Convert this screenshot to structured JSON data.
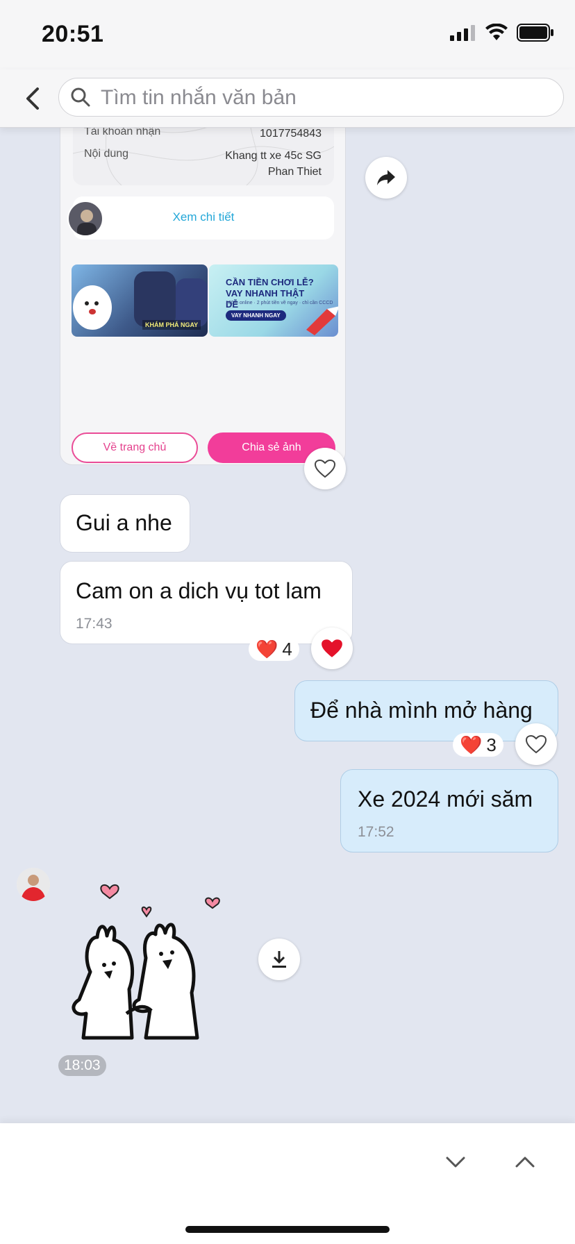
{
  "status_bar": {
    "time": "20:51"
  },
  "search": {
    "placeholder": "Tìm tin nhắn văn bản"
  },
  "receipt": {
    "rows": [
      {
        "label": "Tài khoản nhận",
        "value": "1017754843"
      },
      {
        "label": "Nội dung",
        "value": "Khang tt xe 45c SG Phan Thiet"
      }
    ],
    "detail_link": "Xem chi tiết",
    "banner1_tag": "KHÁM PHÁ NGAY",
    "banner2_title": "CẦN TIỀN CHƠI LỄ? VAY NHANH THẬT DỄ",
    "banner2_sub": "100% online · 2 phút tiền về ngay · chỉ cần CCCD",
    "banner2_button": "VAY NHANH NGAY",
    "button_home": "Về trang chủ",
    "button_share": "Chia sẻ ảnh"
  },
  "messages": [
    {
      "side": "left",
      "text": "Gui a nhe"
    },
    {
      "side": "left",
      "text": "Cam on a dich vụ tot lam",
      "time": "17:43",
      "reaction": {
        "emoji": "❤️",
        "count": "4"
      }
    },
    {
      "side": "right",
      "text": "Để nhà mình mở hàng",
      "reaction": {
        "emoji": "❤️",
        "count": "3"
      }
    },
    {
      "side": "right",
      "text": "Xe 2024 mới săm",
      "time": "17:52"
    }
  ],
  "sticker": {
    "time": "18:03"
  },
  "colors": {
    "accent_pink": "#f23d9a",
    "link_blue": "#23a7d8",
    "my_bubble": "#d7ecfb",
    "background": "#e2e6f0"
  },
  "icons": [
    "back-chevron-icon",
    "search-icon",
    "forward-icon",
    "heart-outline-icon",
    "heart-filled-icon",
    "download-icon",
    "chevron-down-icon",
    "chevron-up-icon",
    "signal-icon",
    "wifi-icon",
    "battery-icon"
  ]
}
